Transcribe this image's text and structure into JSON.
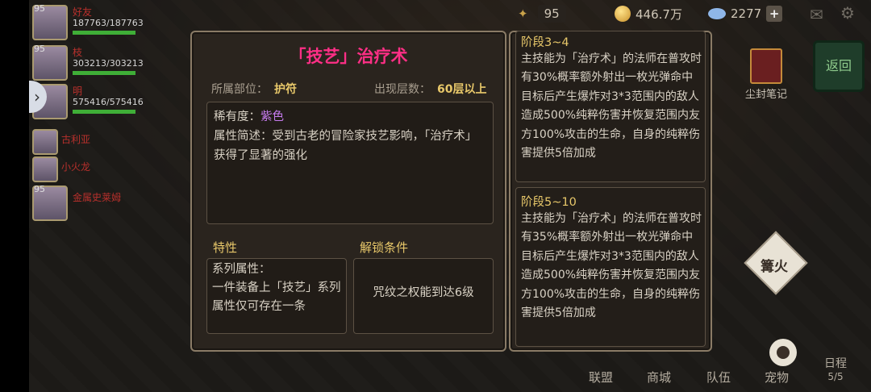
{
  "hud": {
    "level_badge": "95",
    "coins": "446.7万",
    "gems": "2277",
    "plus": "+"
  },
  "party": [
    {
      "level": "95",
      "name": "好友",
      "hp": "187763/187763"
    },
    {
      "level": "95",
      "name": "枝",
      "hp": "303213/303213"
    },
    {
      "level": "",
      "name": "明",
      "hp": "575416/575416"
    },
    {
      "level": "",
      "name": "古利亚",
      "hp": ""
    },
    {
      "level": "",
      "name": "小火龙",
      "hp": ""
    },
    {
      "level": "95",
      "name": "金属史莱姆",
      "hp": ""
    }
  ],
  "right": {
    "return_label": "返回",
    "dust_label": "尘封笔记",
    "bonfire_label": "篝火"
  },
  "bottom_nav": {
    "alliance": "联盟",
    "shop": "商城",
    "team": "队伍",
    "pet": "宠物",
    "schedule": "日程",
    "schedule_count": "5/5"
  },
  "item": {
    "title": "「技艺」治疗术",
    "slot_label": "所属部位：",
    "slot_value": "护符",
    "floor_label": "出现层数：",
    "floor_value": "60层以上",
    "rarity_label": "稀有度：",
    "rarity_value": "紫色",
    "description": "属性简述：受到古老的冒险家技艺影响，「治疗术」获得了显著的强化",
    "trait_heading": "特性",
    "unlock_heading": "解锁条件",
    "trait_text": "系列属性：\n一件装备上「技艺」系列属性仅可存在一条",
    "unlock_text": "咒纹之权能到达6级"
  },
  "stages": [
    {
      "heading": "阶段3~4",
      "text": "主技能为「治疗术」的法师在普攻时有30%概率额外射出一枚光弹命中目标后产生爆炸对3*3范围内的敌人造成500%纯粹伤害并恢复范围内友方100%攻击的生命，自身的纯粹伤害提供5倍加成"
    },
    {
      "heading": "阶段5~10",
      "text": "主技能为「治疗术」的法师在普攻时有35%概率额外射出一枚光弹命中目标后产生爆炸对3*3范围内的敌人造成500%纯粹伤害并恢复范围内友方100%攻击的生命，自身的纯粹伤害提供5倍加成"
    }
  ],
  "colors": {
    "title": "#ff2f86",
    "gold": "#e8c86a",
    "rarity": "#c77cf0"
  }
}
